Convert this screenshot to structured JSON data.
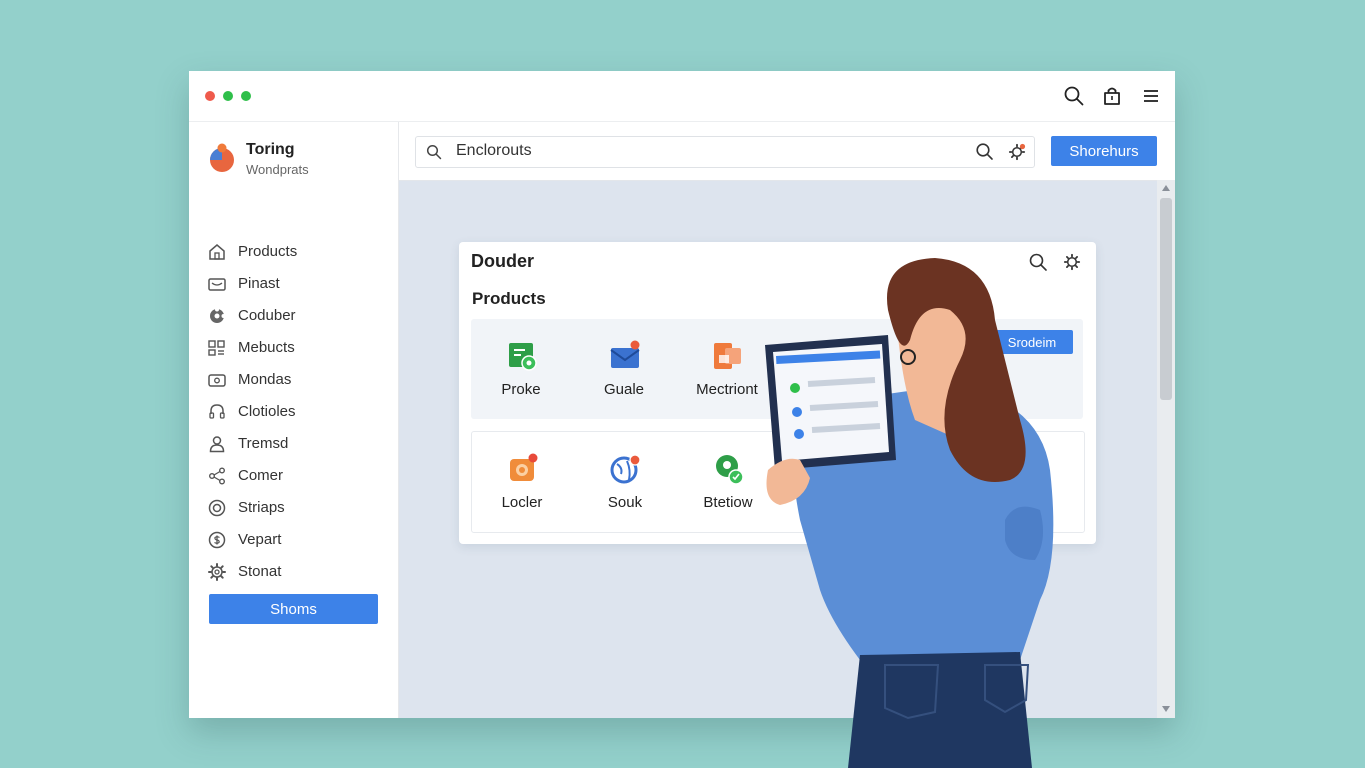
{
  "window": {
    "controls": [
      "close",
      "minimize",
      "maximize"
    ],
    "toolbar_icons": [
      "search-icon",
      "bag-icon",
      "menu-icon"
    ]
  },
  "sidebar": {
    "brand": {
      "name": "Toring",
      "subtitle": "Wondprats"
    },
    "items": [
      {
        "label": "Products",
        "icon": "home-icon"
      },
      {
        "label": "Pinast",
        "icon": "mail-icon"
      },
      {
        "label": "Coduber",
        "icon": "flower-icon"
      },
      {
        "label": "Mebucts",
        "icon": "grid-icon"
      },
      {
        "label": "Mondas",
        "icon": "card-icon"
      },
      {
        "label": "Clotioles",
        "icon": "headset-icon"
      },
      {
        "label": "Tremsd",
        "icon": "user-icon"
      },
      {
        "label": "Comer",
        "icon": "share-icon"
      },
      {
        "label": "Striaps",
        "icon": "target-icon"
      },
      {
        "label": "Vepart",
        "icon": "dollar-icon"
      },
      {
        "label": "Stonat",
        "icon": "gear-icon"
      }
    ],
    "button_label": "Shoms"
  },
  "topbar": {
    "search_value": "Enclorouts",
    "button_label": "Shorehurs"
  },
  "card": {
    "title": "Douder",
    "subtitle": "Products",
    "button_label": "Srodeim",
    "tiles_row1": [
      {
        "label": "Proke",
        "icon": "green-file-icon"
      },
      {
        "label": "Guale",
        "icon": "envelope-icon"
      },
      {
        "label": "Mectriont",
        "icon": "orange-box-icon"
      }
    ],
    "tiles_row2": [
      {
        "label": "Locler",
        "icon": "camera-icon"
      },
      {
        "label": "Souk",
        "icon": "globe-icon"
      },
      {
        "label": "Btetiow",
        "icon": "green-pin-icon"
      }
    ]
  },
  "colors": {
    "accent": "#3d82e8",
    "background": "#93d0cb",
    "content_bg": "#dde4ee"
  }
}
